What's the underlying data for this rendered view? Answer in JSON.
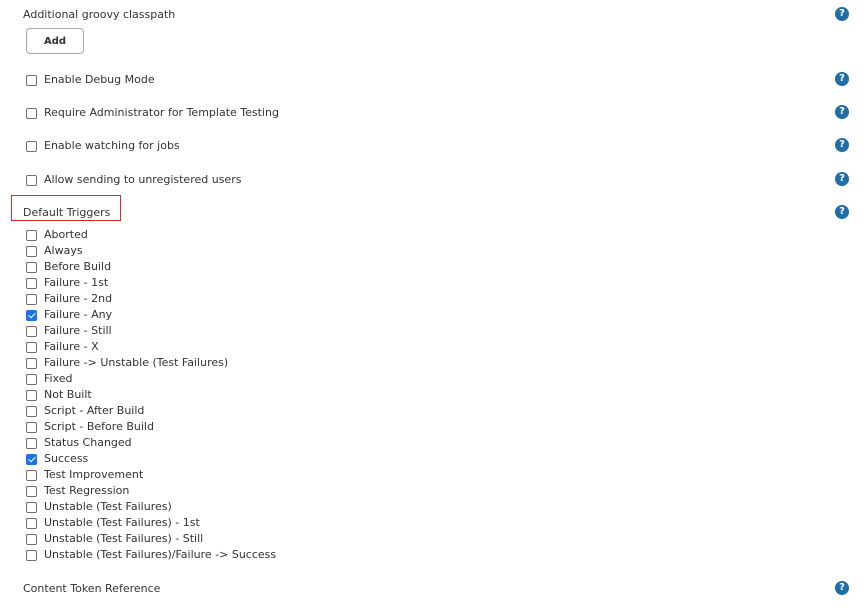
{
  "classpath": {
    "label": "Additional groovy classpath",
    "add_button": "Add",
    "help": "?"
  },
  "options": [
    {
      "label": "Enable Debug Mode",
      "checked": false
    },
    {
      "label": "Require Administrator for Template Testing",
      "checked": false
    },
    {
      "label": "Enable watching for jobs",
      "checked": false
    },
    {
      "label": "Allow sending to unregistered users",
      "checked": false
    }
  ],
  "default_triggers": {
    "label": "Default Triggers",
    "help": "?",
    "items": [
      {
        "label": "Aborted",
        "checked": false
      },
      {
        "label": "Always",
        "checked": false
      },
      {
        "label": "Before Build",
        "checked": false
      },
      {
        "label": "Failure - 1st",
        "checked": false
      },
      {
        "label": "Failure - 2nd",
        "checked": false
      },
      {
        "label": "Failure - Any",
        "checked": true
      },
      {
        "label": "Failure - Still",
        "checked": false
      },
      {
        "label": "Failure - X",
        "checked": false
      },
      {
        "label": "Failure -> Unstable (Test Failures)",
        "checked": false
      },
      {
        "label": "Fixed",
        "checked": false
      },
      {
        "label": "Not Built",
        "checked": false
      },
      {
        "label": "Script - After Build",
        "checked": false
      },
      {
        "label": "Script - Before Build",
        "checked": false
      },
      {
        "label": "Status Changed",
        "checked": false
      },
      {
        "label": "Success",
        "checked": true
      },
      {
        "label": "Test Improvement",
        "checked": false
      },
      {
        "label": "Test Regression",
        "checked": false
      },
      {
        "label": "Unstable (Test Failures)",
        "checked": false
      },
      {
        "label": "Unstable (Test Failures) - 1st",
        "checked": false
      },
      {
        "label": "Unstable (Test Failures) - Still",
        "checked": false
      },
      {
        "label": "Unstable (Test Failures)/Failure -> Success",
        "checked": false
      }
    ]
  },
  "content_token": {
    "label": "Content Token Reference",
    "help": "?"
  },
  "colors": {
    "help_icon": "#1f6ea8",
    "checkbox_checked": "#1a73e8",
    "highlight": "#d32f2f"
  }
}
